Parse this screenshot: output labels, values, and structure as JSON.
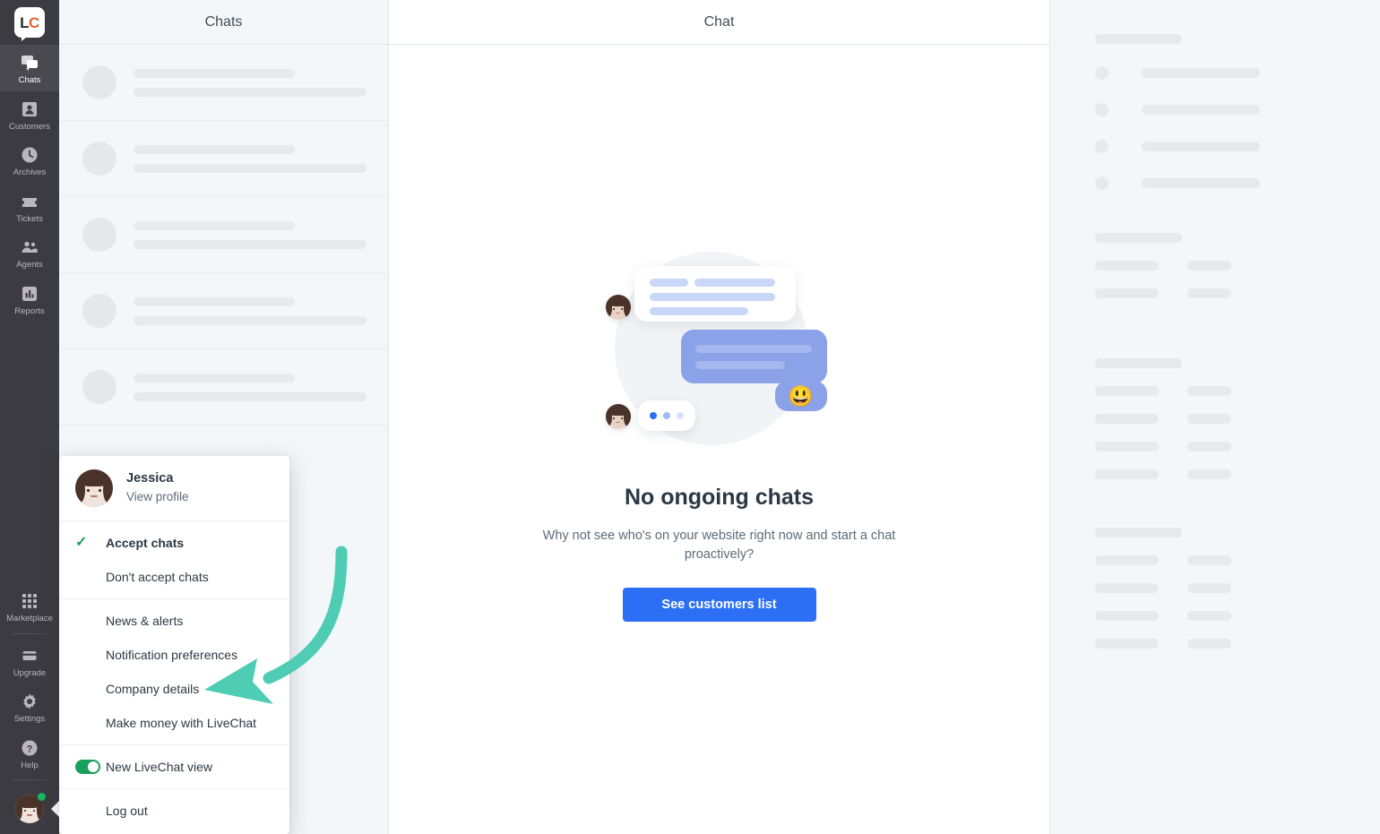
{
  "app": {
    "logo_text_left": "L",
    "logo_text_right": "C",
    "logo_name": "LiveChat"
  },
  "sidebar": {
    "items": [
      {
        "label": "Chats",
        "icon": "chats-icon",
        "active": true
      },
      {
        "label": "Customers",
        "icon": "customers-icon",
        "active": false
      },
      {
        "label": "Archives",
        "icon": "archives-icon",
        "active": false
      },
      {
        "label": "Tickets",
        "icon": "tickets-icon",
        "active": false
      },
      {
        "label": "Agents",
        "icon": "agents-icon",
        "active": false
      },
      {
        "label": "Reports",
        "icon": "reports-icon",
        "active": false
      }
    ],
    "bottom_items": [
      {
        "label": "Marketplace",
        "icon": "grid-icon"
      },
      {
        "label": "Upgrade",
        "icon": "card-icon"
      },
      {
        "label": "Settings",
        "icon": "gear-icon"
      },
      {
        "label": "Help",
        "icon": "help-icon"
      }
    ],
    "avatar_name": "Jessica",
    "status": "online",
    "status_color": "#18b862",
    "background": "#3c3b41"
  },
  "chats_panel": {
    "title": "Chats",
    "skeleton_rows": 5
  },
  "chat_panel": {
    "title": "Chat",
    "empty_state": {
      "heading": "No ongoing chats",
      "description": "Why not see who's on your website right now and start a chat proactively?",
      "button_label": "See customers list",
      "button_color": "#2c6ff5"
    },
    "illustration": {
      "name": "chat-bubbles-illustration",
      "emoji": "😃",
      "typing_dots": 3
    }
  },
  "details_panel": {
    "sections": [
      {
        "type": "header"
      },
      {
        "type": "icon-rows",
        "rows": 4
      },
      {
        "type": "header"
      },
      {
        "type": "pair-rows",
        "rows": 2
      },
      {
        "type": "header"
      },
      {
        "type": "pair-rows",
        "rows": 4
      },
      {
        "type": "header"
      },
      {
        "type": "pair-rows",
        "rows": 4
      }
    ]
  },
  "profile_menu": {
    "name": "Jessica",
    "view_profile_label": "View profile",
    "groups": [
      {
        "items": [
          {
            "label": "Accept chats",
            "control": "check",
            "selected": true
          },
          {
            "label": "Don't accept chats",
            "control": "none",
            "selected": false
          }
        ]
      },
      {
        "items": [
          {
            "label": "News & alerts",
            "control": "none",
            "selected": false
          },
          {
            "label": "Notification preferences",
            "control": "none",
            "selected": false
          },
          {
            "label": "Company details",
            "control": "none",
            "selected": false
          },
          {
            "label": "Make money with LiveChat",
            "control": "none",
            "selected": false
          }
        ]
      },
      {
        "items": [
          {
            "label": "New LiveChat view",
            "control": "toggle",
            "selected": true
          }
        ]
      },
      {
        "items": [
          {
            "label": "Log out",
            "control": "none",
            "selected": false
          }
        ]
      }
    ],
    "accent_green": "#19a05c"
  },
  "annotation": {
    "type": "curved-arrow",
    "color": "#4ecdb4",
    "points_to": "Company details"
  }
}
